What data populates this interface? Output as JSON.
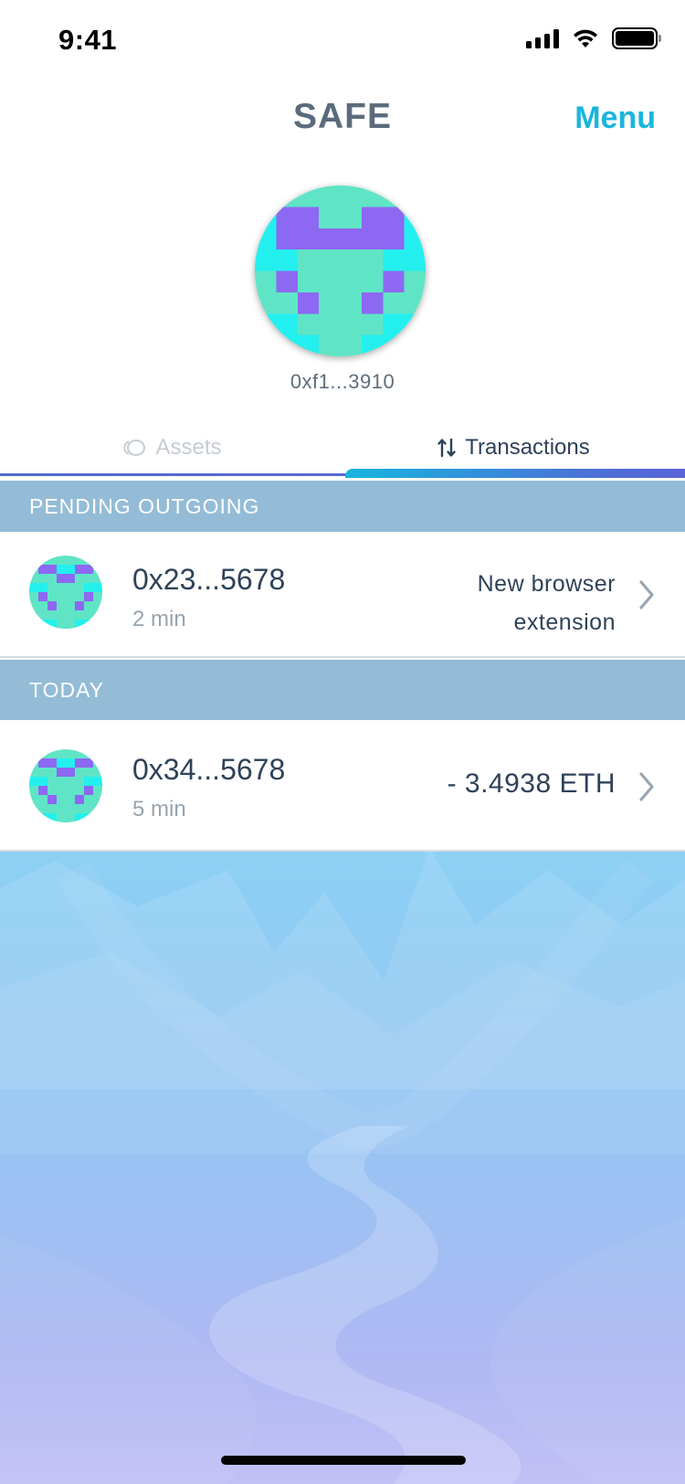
{
  "status": {
    "time": "9:41"
  },
  "header": {
    "title": "SAFE",
    "menu_label": "Menu"
  },
  "safe": {
    "address": "0xf1...3910"
  },
  "tabs": [
    {
      "label": "Assets",
      "icon": "coins-icon",
      "active": false
    },
    {
      "label": "Transactions",
      "icon": "swap-arrows-icon",
      "active": true
    }
  ],
  "sections": [
    {
      "title": "PENDING OUTGOING",
      "items": [
        {
          "address": "0x23...5678",
          "time": "2 min",
          "description_line1": "New browser",
          "description_line2": "extension"
        }
      ]
    },
    {
      "title": "TODAY",
      "items": [
        {
          "address": "0x34...5678",
          "time": "5 min",
          "amount": "- 3.4938 ETH"
        }
      ]
    }
  ],
  "colors": {
    "accent": "#1ab6dd",
    "section_header": "#94bcd6",
    "identicon_primary": "#5fe5c5",
    "identicon_secondary": "#23f0ee",
    "identicon_tertiary": "#8d68f2"
  }
}
